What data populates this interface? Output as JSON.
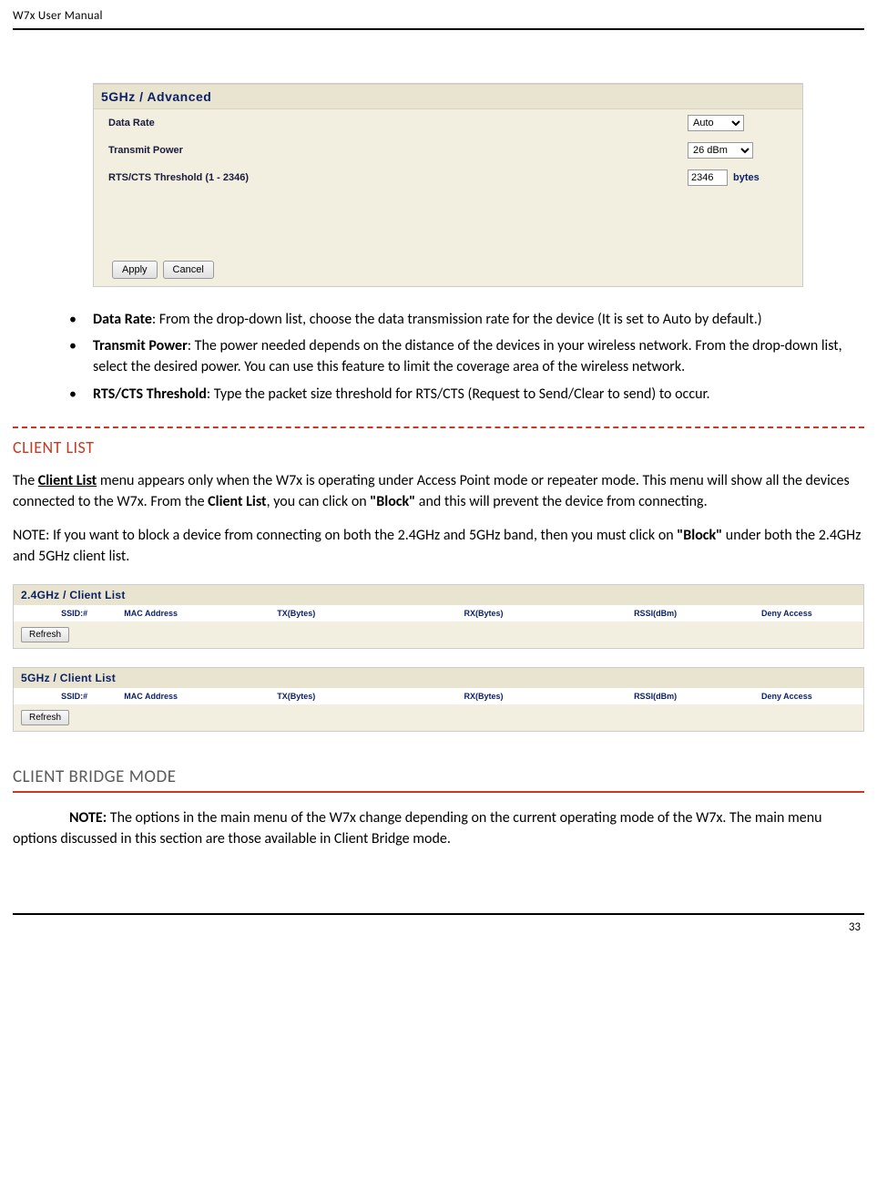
{
  "header": {
    "title_left": "W7x  User ",
    "title_m": "M",
    "title_right": "anual"
  },
  "screenshot1": {
    "title": "5GHz / Advanced",
    "rows": {
      "data_rate_label": "Data Rate",
      "data_rate_value": "Auto",
      "transmit_power_label": "Transmit Power",
      "transmit_power_value": "26 dBm",
      "rts_label": "RTS/CTS Threshold (1 - 2346)",
      "rts_value": "2346",
      "rts_unit": "bytes"
    },
    "apply_label": "Apply",
    "cancel_label": "Cancel"
  },
  "bullets": {
    "b1_strong": "Data Rate",
    "b1_text": ": From the drop-down list, choose the data transmission rate for the device (It is set to Auto by default.)",
    "b2_strong": "Transmit Power",
    "b2_text_a": ": The power needed depends on the ",
    "b2_text_b": "distance of the devices in your wireless network. From the drop-down list, select the desired power. You can use this feature to limit the coverage area of the wireless network.",
    "b3_strong": "RTS/CTS Threshold",
    "b3_text": ": Type the packet size threshold for RTS/CTS (Request to Send/Clear to send) to occur."
  },
  "section1_title": "CLIENT LIST",
  "para1_a": "The ",
  "para1_b": "Client List",
  "para1_c": " menu appears only when the W7x is operating under Access Point mode or repeater mode. This menu will show all the devices connected to the W7x. From the ",
  "para1_d": "Client List",
  "para1_e": ", you can click on ",
  "para1_f": "\"Block\"",
  "para1_g": " and this will prevent the device from connecting.",
  "para2_a": "NOTE: If you want to block a device from connecting on both the 2.4GHz and 5GHz band, then you must click on ",
  "para2_b": "\"Block\"",
  "para2_c": " under both the 2.4GHz and 5GHz client list.",
  "clientlist": {
    "list24_title": "2.4GHz / Client List",
    "list5_title": "5GHz / Client List",
    "cols": {
      "c1": "SSID:#",
      "c2": "MAC Address",
      "c3": "TX(Bytes)",
      "c4": "RX(Bytes)",
      "c5": "RSSI(dBm)",
      "c6": "Deny Access"
    },
    "refresh_label": "Refresh"
  },
  "section2_title": "CLIENT BRIDGE MODE",
  "para3_a": "NOTE:",
  "para3_b": " The options in the main menu of the W7x change depending on the current operating mode of the W7x. The main menu options discussed in this section are those available in Client Bridge mode.",
  "footer": {
    "page_number": "33"
  }
}
